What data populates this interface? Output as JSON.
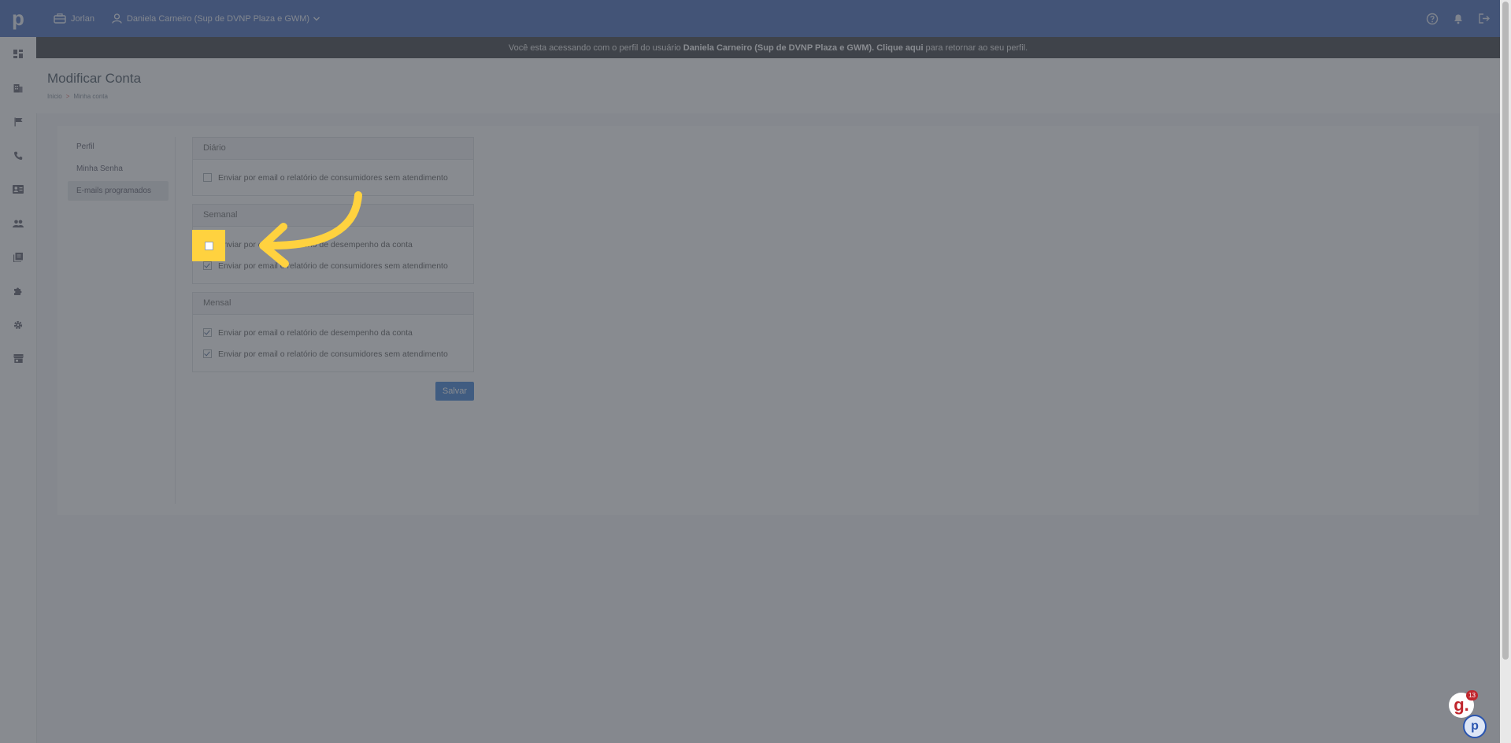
{
  "topbar": {
    "logo_letter": "p",
    "company": "Jorlan",
    "profile": "Daniela Carneiro (Sup de DVNP Plaza e GWM)"
  },
  "sidebar": {
    "items": [
      {
        "icon": "dashboard-icon"
      },
      {
        "icon": "building-icon"
      },
      {
        "icon": "flag-icon"
      },
      {
        "icon": "phone-icon"
      },
      {
        "icon": "contact-card-icon"
      },
      {
        "icon": "users-icon"
      },
      {
        "icon": "book-icon"
      },
      {
        "icon": "puzzle-icon"
      },
      {
        "icon": "gear-icon"
      },
      {
        "icon": "store-icon"
      }
    ]
  },
  "impersonation": {
    "prefix": "Você esta acessando com o perfil do usuário",
    "user": "Daniela Carneiro (Sup de DVNP Plaza e GWM).",
    "link": "Clique aqui",
    "suffix": "para retornar ao seu perfil."
  },
  "page": {
    "title": "Modificar Conta",
    "breadcrumb": [
      "Inicio",
      "Minha conta"
    ]
  },
  "tabs": [
    "Perfil",
    "Minha Senha",
    "E-mails programados"
  ],
  "active_tab": "E-mails programados",
  "sections": [
    {
      "title": "Diário",
      "options": [
        {
          "label": "Enviar por email o relatório de consumidores sem atendimento",
          "checked": false
        }
      ]
    },
    {
      "title": "Semanal",
      "options": [
        {
          "label": "Enviar por email o relatório de desempenho da conta",
          "checked": false
        },
        {
          "label": "Enviar por email o relatório de consumidores sem atendimento",
          "checked": true
        }
      ]
    },
    {
      "title": "Mensal",
      "options": [
        {
          "label": "Enviar por email o relatório de desempenho da conta",
          "checked": true
        },
        {
          "label": "Enviar por email o relatório de consumidores sem atendimento",
          "checked": true
        }
      ]
    }
  ],
  "save_label": "Salvar",
  "widget": {
    "g_letter": "g.",
    "badge": "13",
    "p_letter": "p"
  },
  "colors": {
    "topbar": "#2a55b0",
    "highlight": "#ffd23f",
    "primary_button": "#1f6fd1"
  }
}
